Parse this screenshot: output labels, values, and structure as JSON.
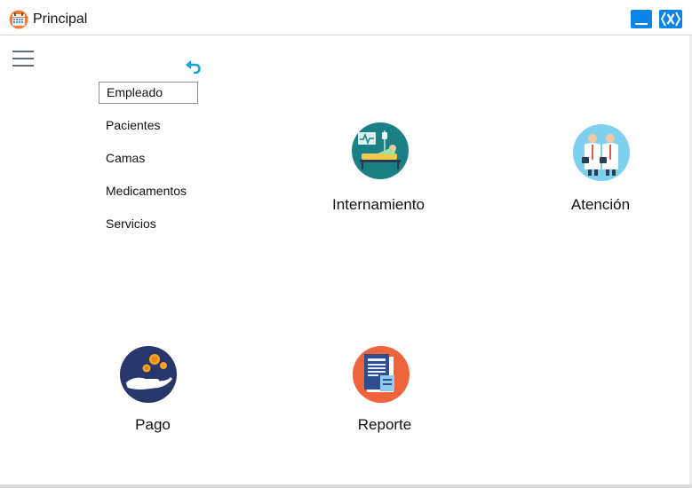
{
  "window": {
    "title": "Principal",
    "minimize_icon": "minimize-icon",
    "close_icon": "close-icon",
    "accent_color": "#0a84e8"
  },
  "sidebar": {
    "menu_icon": "hamburger-menu-icon",
    "back_icon": "undo-arrow-icon",
    "items": [
      {
        "label": "Empleado",
        "selected": true
      },
      {
        "label": "Pacientes"
      },
      {
        "label": "Camas"
      },
      {
        "label": "Medicamentos"
      },
      {
        "label": "Servicios"
      }
    ]
  },
  "main": {
    "tiles": [
      {
        "label": "Internamiento",
        "icon": "hospital-bed-icon"
      },
      {
        "label": "Atención",
        "icon": "doctors-icon"
      },
      {
        "label": "Pago",
        "icon": "hand-coins-icon"
      },
      {
        "label": "Reporte",
        "icon": "report-document-icon"
      }
    ]
  }
}
